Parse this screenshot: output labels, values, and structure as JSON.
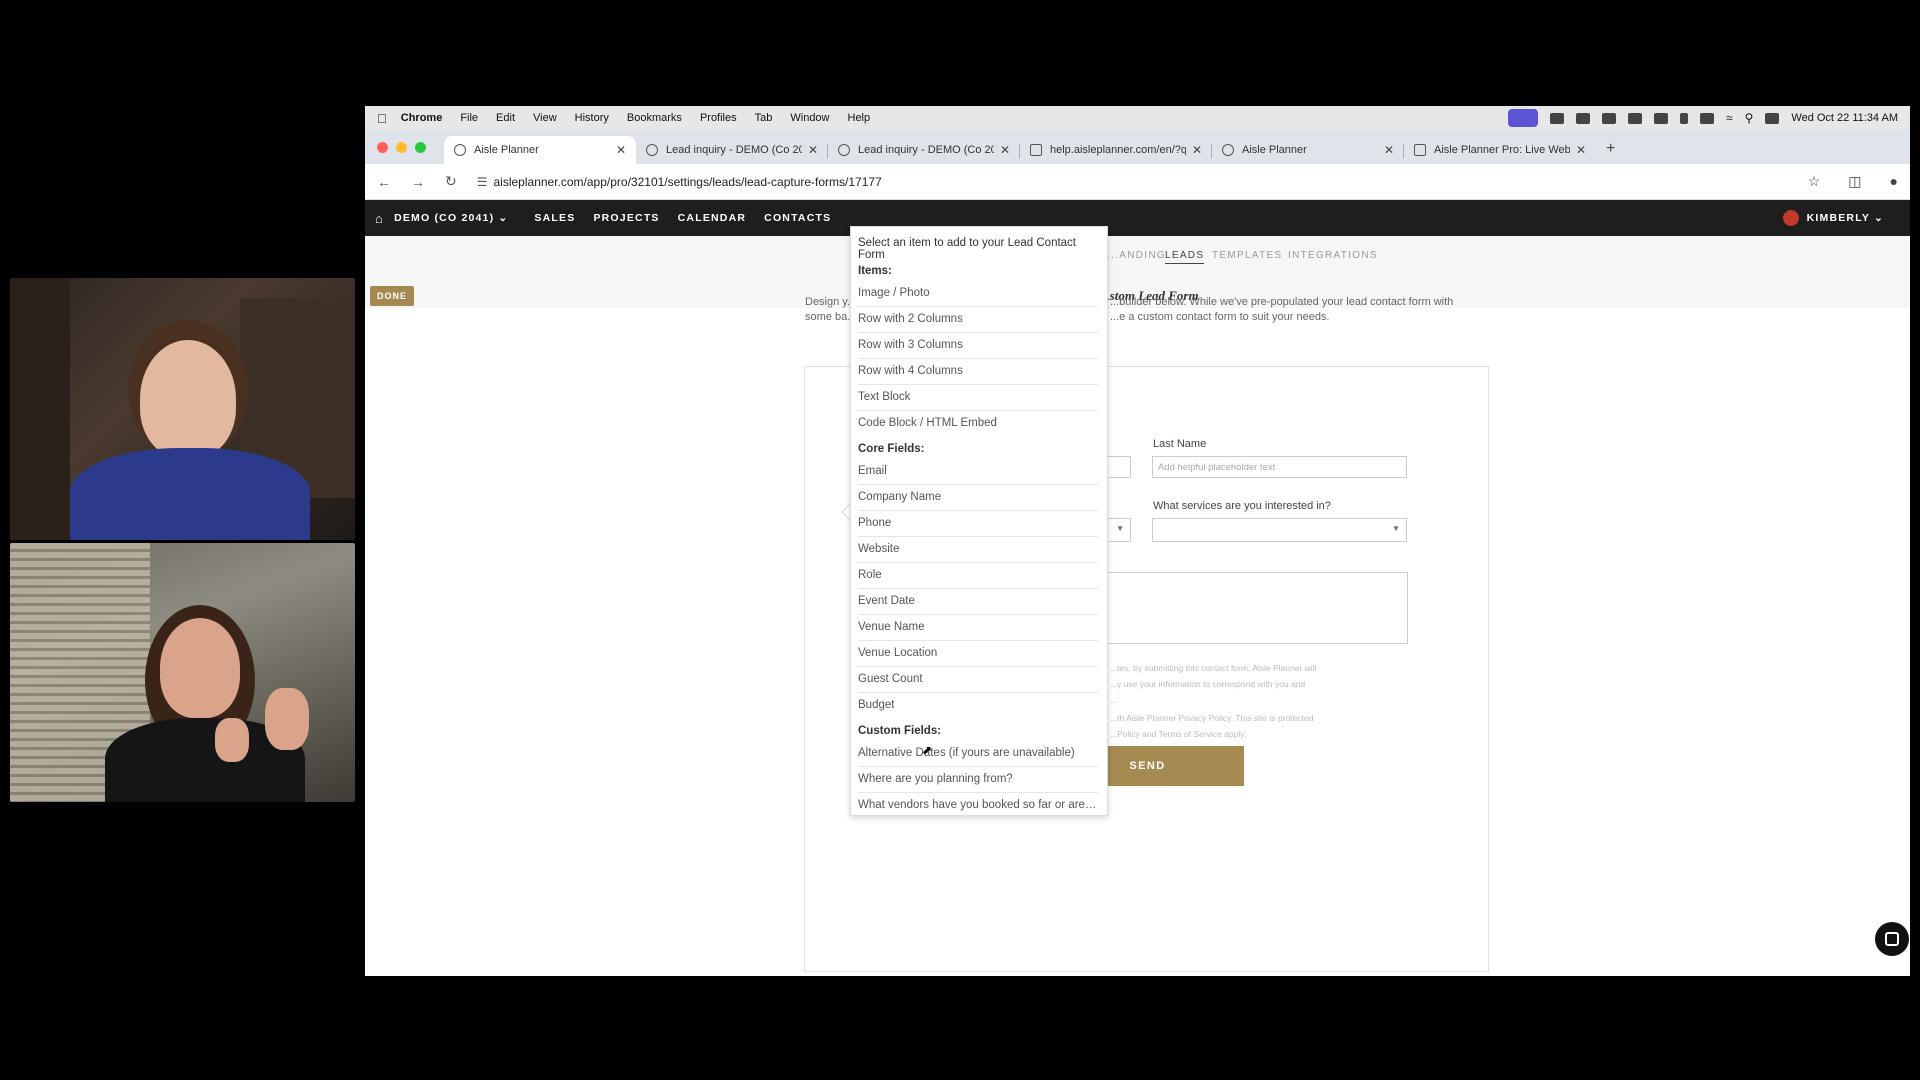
{
  "mac_menu": {
    "app": "Chrome",
    "items": [
      "File",
      "Edit",
      "View",
      "History",
      "Bookmarks",
      "Profiles",
      "Tab",
      "Window",
      "Help"
    ],
    "clock": "Wed Oct 22  11:34 AM"
  },
  "tabs": [
    {
      "label": "Aisle Planner"
    },
    {
      "label": "Lead inquiry - DEMO (Co 20..."
    },
    {
      "label": "Lead inquiry - DEMO (Co 20..."
    },
    {
      "label": "help.aisleplanner.com/en/?q..."
    },
    {
      "label": "Aisle Planner"
    },
    {
      "label": "Aisle Planner Pro: Live Webi..."
    }
  ],
  "address": {
    "url": "aisleplanner.com/app/pro/32101/settings/leads/lead-capture-forms/17177"
  },
  "app_nav": {
    "org": "DEMO (CO 2041) ⌄",
    "items": [
      "SALES",
      "PROJECTS",
      "CALENDAR",
      "CONTACTS"
    ],
    "user": "KIMBERLY ⌄"
  },
  "subnav": {
    "items": [
      "...ANDING",
      "LEADS",
      "TEMPLATES",
      "INTEGRATIONS"
    ],
    "done_label": "DONE",
    "form_title": "...stom Lead Form",
    "intro_line1_left": "Design y...",
    "intro_line1_right": "...builder below. While we've pre-populated your lead contact form with",
    "intro_line2_left": "some ba...",
    "intro_line2_right": "...e a custom contact form to suit your needs."
  },
  "form": {
    "last_name_label": "Last Name",
    "last_name_placeholder": "Add helpful placeholder text",
    "services_label": "What services are you interested in?",
    "legal_1": "...tes, by submitting this contact form, Aisle Planner will",
    "legal_2": "...y use your information to correspond with you and",
    "legal_3": "...",
    "legal_4": "...th Aisle Planner Privacy Policy. This site is protected",
    "legal_5": "...Policy and Terms of Service apply.",
    "send_label": "SEND"
  },
  "dropdown": {
    "title": "Select an item to add to your Lead Contact Form",
    "groups": [
      {
        "heading": "Items:",
        "items": [
          "Image / Photo",
          "Row with 2 Columns",
          "Row with 3 Columns",
          "Row with 4 Columns",
          "Text Block",
          "Code Block / HTML Embed"
        ]
      },
      {
        "heading": "Core Fields:",
        "items": [
          "Email",
          "Company Name",
          "Phone",
          "Website",
          "Role",
          "Event Date",
          "Venue Name",
          "Venue Location",
          "Guest Count",
          "Budget"
        ]
      },
      {
        "heading": "Custom Fields:",
        "items": [
          "Alternative Dates (if yours are unavailable)",
          "Where are you planning from?",
          "What vendors have you booked so far or are c..."
        ]
      }
    ]
  },
  "colors": {
    "accent_gold": "#a58a52",
    "nav_dark": "#1e1e1e"
  }
}
